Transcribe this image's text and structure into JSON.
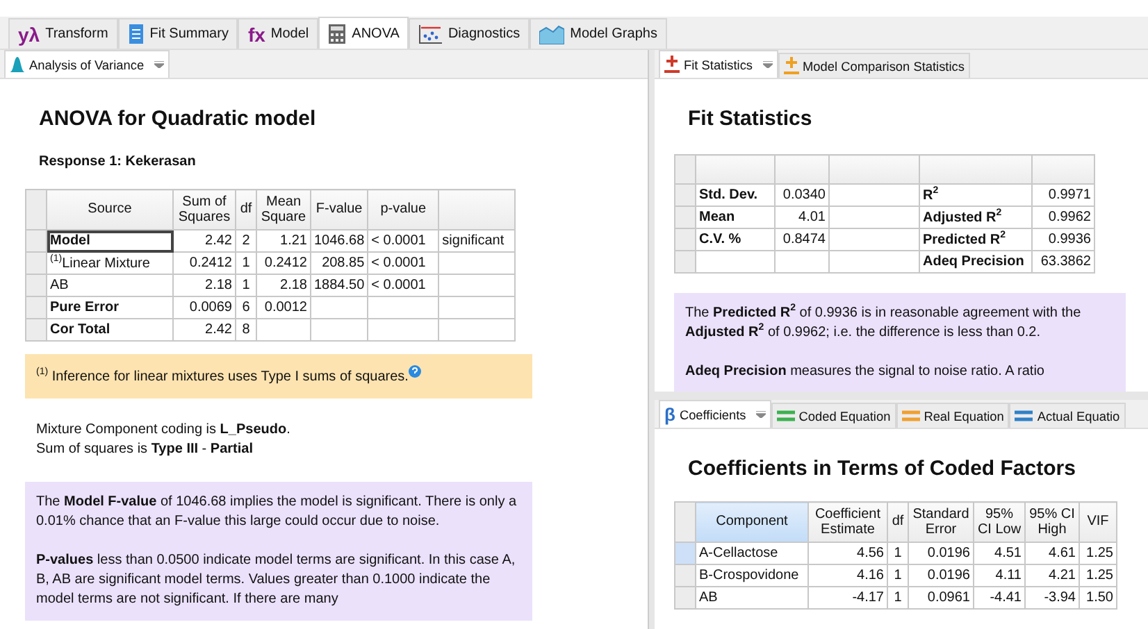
{
  "main_tabs": [
    {
      "label": "Transform",
      "glyph": "yλ",
      "selected": false
    },
    {
      "label": "Fit Summary",
      "kind": "document",
      "selected": false
    },
    {
      "label": "Model",
      "glyph": "fx",
      "selected": false
    },
    {
      "label": "ANOVA",
      "kind": "calculator",
      "selected": true
    },
    {
      "label": "Diagnostics",
      "kind": "scatter",
      "selected": false
    },
    {
      "label": "Model Graphs",
      "kind": "area",
      "selected": false
    }
  ],
  "anova_pane": {
    "tabs": [
      {
        "label": "Analysis of Variance",
        "kind": "bell",
        "selected": true
      }
    ],
    "title": "ANOVA for Quadratic model",
    "response": "Response 1: Kekerasan",
    "table": {
      "columns": [
        "Source",
        "Sum of Squares",
        "df",
        "Mean Square",
        "F-value",
        "p-value"
      ],
      "rows": [
        {
          "cells": [
            "Model",
            "2.42",
            "2",
            "1.21",
            "1046.68",
            "< 0.0001",
            "significant"
          ],
          "bold": true,
          "selected": true
        },
        {
          "cells": [
            "$^{(1)}$Linear Mixture",
            "0.2412",
            "1",
            "0.2412",
            "208.85",
            "< 0.0001",
            ""
          ],
          "bold": false,
          "selected": false
        },
        {
          "cells": [
            "AB",
            "2.18",
            "1",
            "2.18",
            "1884.50",
            "< 0.0001",
            ""
          ],
          "bold": false,
          "selected": false
        },
        {
          "cells": [
            "Pure Error",
            "0.0069",
            "6",
            "0.0012",
            "",
            "",
            ""
          ],
          "bold": true,
          "selected": false
        },
        {
          "cells": [
            "Cor Total",
            "2.42",
            "8",
            "",
            "",
            "",
            ""
          ],
          "bold": true,
          "selected": false
        }
      ]
    },
    "footnote": "$^{(1)}$ Inference for linear mixtures uses Type I sums of squares.",
    "coding": [
      "Mixture Component coding is **L_Pseudo**.",
      "Sum of squares is **Type III** - **Partial**"
    ],
    "interpretation": [
      "The **Model F-value** of 1046.68 implies the model is significant. There is only a 0.01% chance that an F-value this large could occur due to noise.",
      "**P-values** less than 0.0500 indicate model terms are significant. In this case A, B, AB are significant model terms. Values greater than 0.1000 indicate the model terms are not significant. If there are many"
    ]
  },
  "fit_pane": {
    "tabs": [
      {
        "label": "Fit Statistics",
        "kind": "plusminus",
        "color": "#d03a2a",
        "selected": true
      },
      {
        "label": "Model Comparison Statistics",
        "kind": "plusminus",
        "color": "#f0a020",
        "selected": false
      }
    ],
    "title": "Fit Statistics",
    "table": {
      "rows": [
        {
          "cells": [
            "Std. Dev.",
            "0.0340",
            "",
            "R$^{2}$",
            "0.9971"
          ]
        },
        {
          "cells": [
            "Mean",
            "4.01",
            "",
            "Adjusted R$^{2}$",
            "0.9962"
          ]
        },
        {
          "cells": [
            "C.V. %",
            "0.8474",
            "",
            "Predicted R$^{2}$",
            "0.9936"
          ]
        },
        {
          "cells": [
            "",
            "",
            "",
            "Adeq Precision",
            "63.3862"
          ]
        }
      ]
    },
    "interpretation": [
      "The **Predicted R$^{2}$** of 0.9936 is in reasonable agreement with the **Adjusted R$^{2}$** of 0.9962; i.e. the difference is less than 0.2.",
      "**Adeq Precision** measures the signal to noise ratio. A ratio"
    ]
  },
  "coef_pane": {
    "tabs": [
      {
        "label": "Coefficients",
        "glyph": "β",
        "selected": true
      },
      {
        "label": "Coded Equation",
        "kind": "equation",
        "color": "#3cb050",
        "selected": false
      },
      {
        "label": "Real Equation",
        "kind": "equation",
        "color": "#f0a030",
        "selected": false
      },
      {
        "label": "Actual Equatio",
        "kind": "equation",
        "color": "#3080c8",
        "selected": false
      }
    ],
    "title": "Coefficients in Terms of Coded Factors",
    "table": {
      "columns": [
        "Component",
        "Coefficient Estimate",
        "df",
        "Standard Error",
        "95% CI Low",
        "95% CI High",
        "VIF"
      ],
      "rows": [
        {
          "cells": [
            "A-Cellactose",
            "4.56",
            "1",
            "0.0196",
            "4.51",
            "4.61",
            "1.25"
          ],
          "selected": true
        },
        {
          "cells": [
            "B-Crospovidone",
            "4.16",
            "1",
            "0.0196",
            "4.11",
            "4.21",
            "1.25"
          ],
          "selected": false
        },
        {
          "cells": [
            "AB",
            "-4.17",
            "1",
            "0.0961",
            "-4.41",
            "-3.94",
            "1.50"
          ],
          "selected": false
        }
      ]
    }
  }
}
